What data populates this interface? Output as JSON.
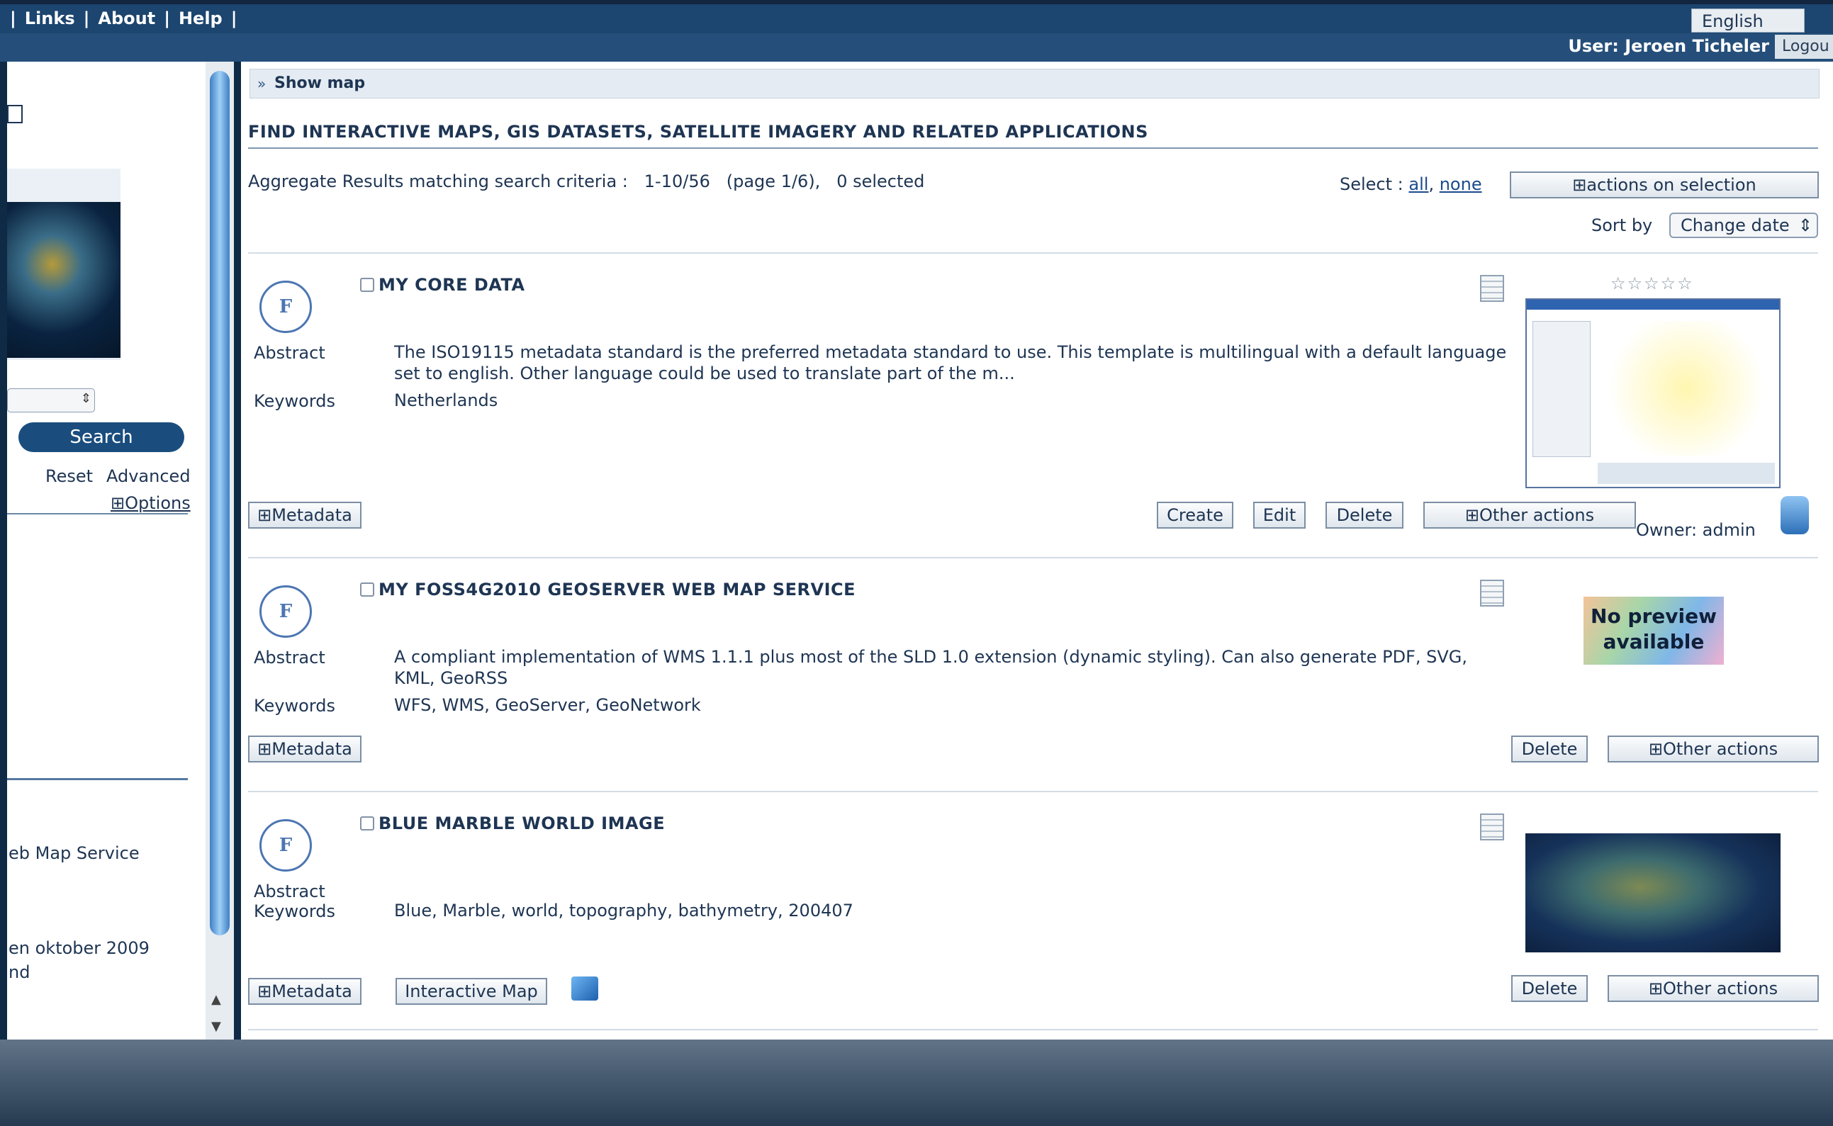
{
  "topbar": {
    "links": [
      "|",
      "Links",
      "|",
      "About",
      "|",
      "Help",
      "|"
    ],
    "language": "English"
  },
  "userbar": {
    "user": "User: Jeroen Ticheler",
    "logout": "Logou"
  },
  "left": {
    "search_label": "Search",
    "reset_label": "Reset",
    "advanced_label": "Advanced",
    "options_label": "⊞Options",
    "text1": "eb Map Service",
    "text2": "en oktober 2009",
    "text3": "nd"
  },
  "main": {
    "show_map": "Show map",
    "heading": "FIND INTERACTIVE MAPS, GIS DATASETS, SATELLITE IMAGERY AND RELATED APPLICATIONS",
    "aggregate": "Aggregate Results matching search criteria :   1-10/56   (page 1/6),   0 selected",
    "select_label": "Select :",
    "select_all": "all",
    "select_none": "none",
    "actions_on_selection": "⊞actions on selection",
    "sort_by": "Sort by",
    "sort_value": "Change date",
    "abstract_label": "Abstract",
    "keywords_label": "Keywords",
    "metadata_label": "⊞Metadata",
    "owner": "Owner: admin",
    "no_preview": "No preview available",
    "records": [
      {
        "title": "MY CORE DATA",
        "abstract": "The ISO19115 metadata standard is the preferred metadata standard to use. This template is multilingual with a default language set to english. Other language could be used to translate part of the m...",
        "keywords": "Netherlands",
        "create": "Create",
        "edit": "Edit",
        "delete": "Delete",
        "other_actions": "⊞Other actions"
      },
      {
        "title": "MY FOSS4G2010 GEOSERVER WEB MAP SERVICE",
        "abstract": "A compliant implementation of WMS 1.1.1 plus most of the SLD 1.0 extension (dynamic styling). Can also generate PDF, SVG, KML, GeoRSS",
        "keywords": "WFS, WMS, GeoServer, GeoNetwork",
        "delete": "Delete",
        "other_actions": "⊞Other actions"
      },
      {
        "title": "BLUE MARBLE WORLD IMAGE",
        "keywords": "Blue, Marble, world, topography, bathymetry, 200407",
        "interactive_map": "Interactive Map",
        "delete": "Delete",
        "other_actions": "⊞Other actions"
      }
    ]
  }
}
